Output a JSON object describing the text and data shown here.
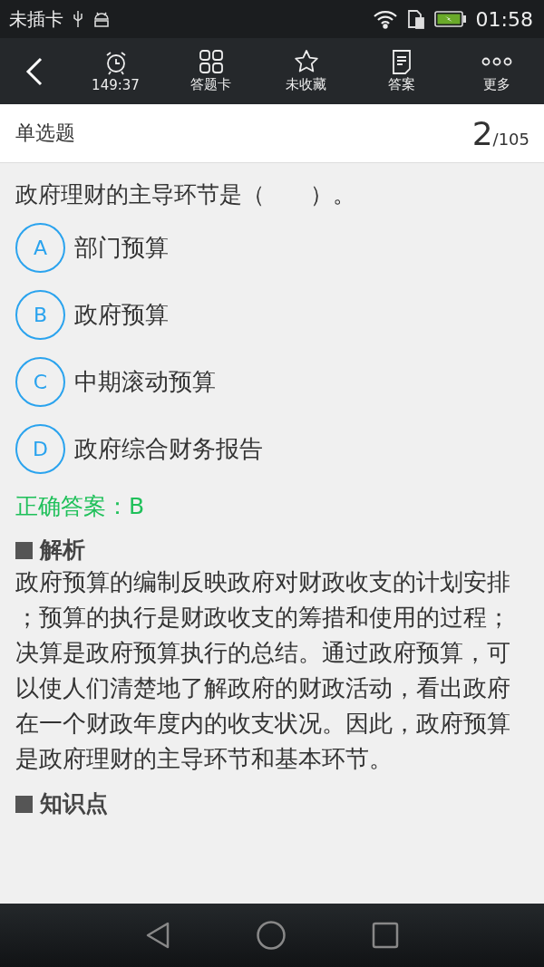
{
  "status_bar": {
    "carrier": "未插卡",
    "time": "01:58"
  },
  "toolbar": {
    "items": [
      {
        "label": "149:37"
      },
      {
        "label": "答题卡"
      },
      {
        "label": "未收藏"
      },
      {
        "label": "答案"
      },
      {
        "label": "更多"
      }
    ]
  },
  "header": {
    "title": "单选题",
    "current": "2",
    "total": "/105"
  },
  "question": "政府理财的主导环节是（　　）。",
  "options": [
    {
      "letter": "A",
      "text": "部门预算"
    },
    {
      "letter": "B",
      "text": "政府预算"
    },
    {
      "letter": "C",
      "text": "中期滚动预算"
    },
    {
      "letter": "D",
      "text": "政府综合财务报告"
    }
  ],
  "answer": "正确答案：B",
  "sections": [
    {
      "title": "解析",
      "body": "政府预算的编制反映政府对财政收支的计划安排；预算的执行是财政收支的筹措和使用的过程；决算是政府预算执行的总结。通过政府预算，可以使人们清楚地了解政府的财政活动，看出政府在一个财政年度内的收支状况。因此，政府预算是政府理财的主导环节和基本环节。"
    },
    {
      "title": "知识点"
    }
  ]
}
